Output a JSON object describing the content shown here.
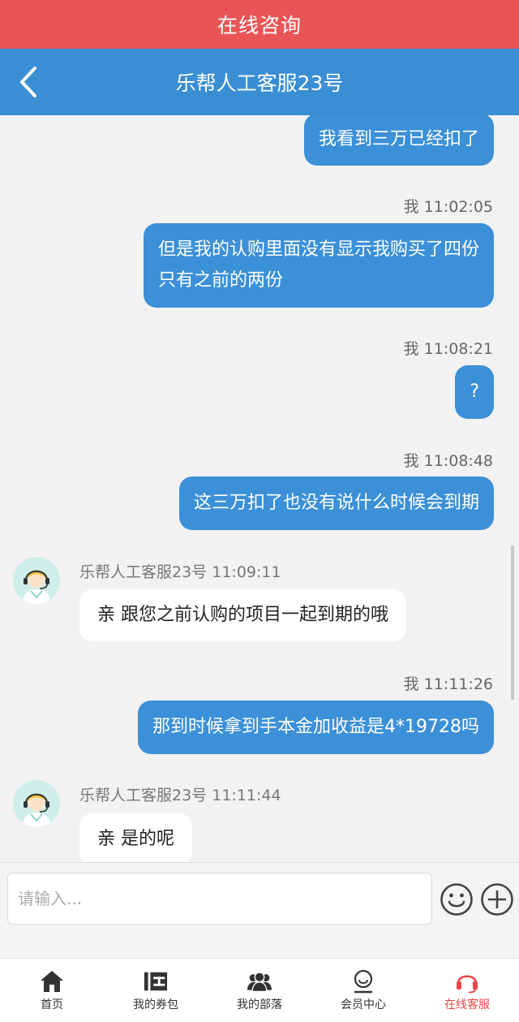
{
  "banner": {
    "title": "在线咨询"
  },
  "header": {
    "title": "乐帮人工客服23号"
  },
  "messages": [
    {
      "side": "out",
      "text": "我看到三万已经扣了"
    },
    {
      "side": "out",
      "sender": "我",
      "time": "11:02:05",
      "lines": [
        "但是我的认购里面没有显示我购买了四份",
        "只有之前的两份"
      ]
    },
    {
      "side": "out",
      "sender": "我",
      "time": "11:08:21",
      "text": "?"
    },
    {
      "side": "out",
      "sender": "我",
      "time": "11:08:48",
      "text": "这三万扣了也没有说什么时候会到期"
    },
    {
      "side": "in",
      "sender": "乐帮人工客服23号",
      "time": "11:09:11",
      "text": "亲 跟您之前认购的项目一起到期的哦"
    },
    {
      "side": "out",
      "sender": "我",
      "time": "11:11:26",
      "text": "那到时候拿到手本金加收益是4*19728吗"
    },
    {
      "side": "in",
      "sender": "乐帮人工客服23号",
      "time": "11:11:44",
      "text": "亲 是的呢"
    }
  ],
  "input": {
    "placeholder": "请输入..."
  },
  "tabs": [
    {
      "label": "首页",
      "icon": "home-icon"
    },
    {
      "label": "我的券包",
      "icon": "coupon-icon"
    },
    {
      "label": "我的部落",
      "icon": "group-icon"
    },
    {
      "label": "会员中心",
      "icon": "member-icon"
    },
    {
      "label": "在线客服",
      "icon": "headset-icon",
      "active": true
    }
  ],
  "colors": {
    "banner": "#e95556",
    "header": "#3a8ed3",
    "bubble_out": "#3b90d8",
    "active_tab": "#e94548"
  }
}
